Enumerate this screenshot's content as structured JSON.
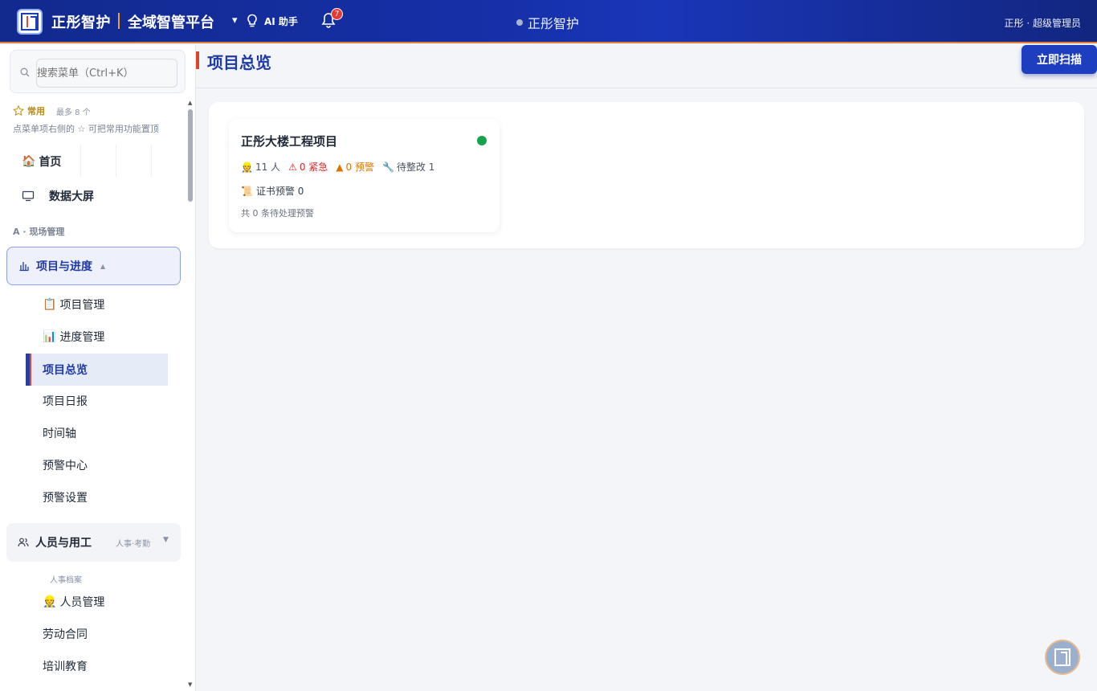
{
  "header": {
    "brand": "正彤智护",
    "platform": "全域智管平台",
    "caret": "▾",
    "ai_label": "AI 助手",
    "notification_count": "7",
    "center_title": "正彤智护",
    "user": "正彤 · 超级管理员"
  },
  "sidebar": {
    "search_placeholder": "搜索菜单（Ctrl+K）",
    "fav_label": "常用",
    "fav_max": "最多 8 个",
    "fav_hint": "点菜单项右侧的 ☆ 可把常用功能置顶",
    "home_icon": "🏠",
    "home": "首页",
    "screen": "数据大屏",
    "section_a": "A · 现场管理",
    "group_projects": {
      "label": "项目与进度",
      "caret": "▲",
      "items": [
        {
          "icon": "📋",
          "label": "项目管理"
        },
        {
          "icon": "📊",
          "label": "进度管理"
        },
        {
          "icon": "",
          "label": "项目总览"
        },
        {
          "icon": "",
          "label": "项目日报"
        },
        {
          "icon": "",
          "label": "时间轴"
        },
        {
          "icon": "",
          "label": "预警中心"
        },
        {
          "icon": "",
          "label": "预警设置"
        }
      ]
    },
    "group_people": {
      "label": "人员与用工",
      "tag": "人事·考勤",
      "caret": "▼",
      "sub_head": "人事档案",
      "items": [
        {
          "icon": "👷",
          "label": "人员管理"
        },
        {
          "icon": "",
          "label": "劳动合同"
        },
        {
          "icon": "",
          "label": "培训教育"
        }
      ]
    }
  },
  "main": {
    "title": "项目总览",
    "scan_button": "立即扫描",
    "card": {
      "title": "正彤大楼工程项目",
      "status_color": "#16a34a",
      "people_icon": "👷",
      "people": "11 人",
      "urgent_icon": "⚠",
      "urgent": "0 紧急",
      "warn_icon": "▲",
      "warn": "0 预警",
      "fix_icon": "🔧",
      "fix": "待整改 1",
      "cert_icon": "📜",
      "cert": "证书预警 0",
      "pending": "共 0 条待处理预警"
    }
  }
}
